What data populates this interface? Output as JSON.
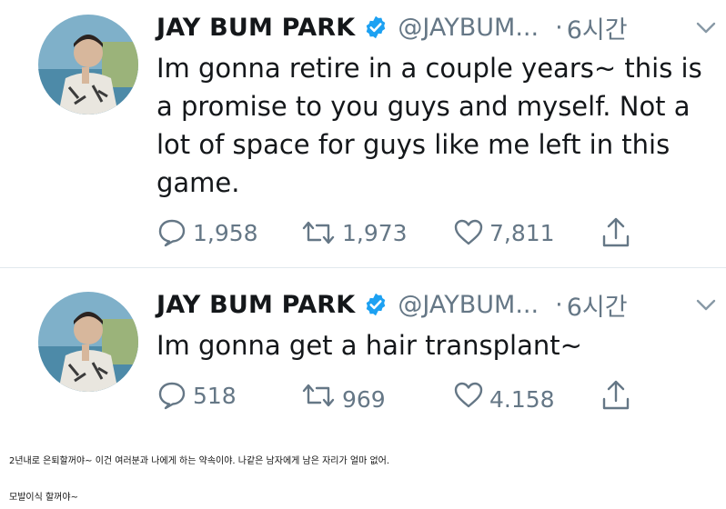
{
  "tweets": [
    {
      "author_name": "JAY BUM PARK",
      "handle": "@JAYBUM...",
      "separator": "·",
      "time": "6시간",
      "text": "Im gonna retire in a couple years~ this is a promise to you guys and myself.  Not a lot of space for guys like me left in this game.",
      "replies": "1,958",
      "retweets": "1,973",
      "likes": "7,811"
    },
    {
      "author_name": "JAY BUM PARK",
      "handle": "@JAYBUM...",
      "separator": "·",
      "time": "6시간",
      "text": "Im gonna get a hair transplant~",
      "replies": "518",
      "retweets": "969",
      "likes": "4.158"
    }
  ],
  "captions": [
    "2년내로 은퇴할꺼야~ 이건 여러분과 나에게 하는 약속이야. 나같은 남자에게 남은 자리가 얼마 없어.",
    "모발이식 할꺼야~"
  ],
  "colors": {
    "text": "#14171a",
    "secondary": "#657786",
    "verified": "#1da1f2",
    "divider": "#e1e8ed"
  },
  "icons": [
    "verified-badge-icon",
    "chevron-down-icon",
    "reply-icon",
    "retweet-icon",
    "like-icon",
    "share-icon"
  ]
}
